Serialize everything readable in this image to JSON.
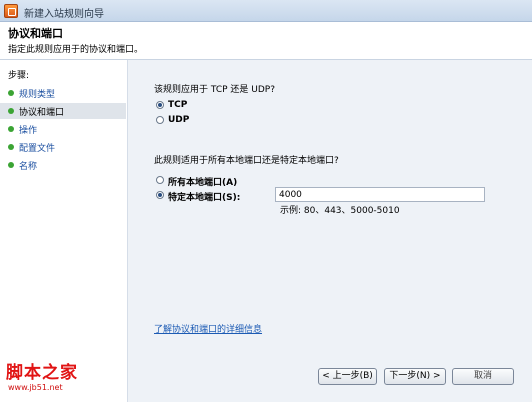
{
  "window": {
    "title": "新建入站规则向导"
  },
  "header": {
    "title": "协议和端口",
    "subtitle": "指定此规则应用于的协议和端口。"
  },
  "sidebar": {
    "heading": "步骤:",
    "steps": [
      {
        "label": "规则类型",
        "active": false
      },
      {
        "label": "协议和端口",
        "active": true
      },
      {
        "label": "操作",
        "active": false
      },
      {
        "label": "配置文件",
        "active": false
      },
      {
        "label": "名称",
        "active": false
      }
    ]
  },
  "protocol": {
    "question": "该规则应用于 TCP 还是 UDP?",
    "options": [
      {
        "label": "TCP",
        "selected": true
      },
      {
        "label": "UDP",
        "selected": false
      }
    ]
  },
  "ports": {
    "question": "此规则适用于所有本地端口还是特定本地端口?",
    "options": [
      {
        "label": "所有本地端口(A)",
        "selected": false
      },
      {
        "label": "特定本地端口(S):",
        "selected": true
      }
    ],
    "value": "4000",
    "example": "示例: 80、443、5000-5010"
  },
  "links": {
    "learn_more": "了解协议和端口的详细信息"
  },
  "buttons": {
    "back": "< 上一步(B)",
    "next": "下一步(N) >",
    "cancel": "取消"
  },
  "watermark": {
    "main": "脚本之家",
    "url": "www.jb51.net"
  }
}
